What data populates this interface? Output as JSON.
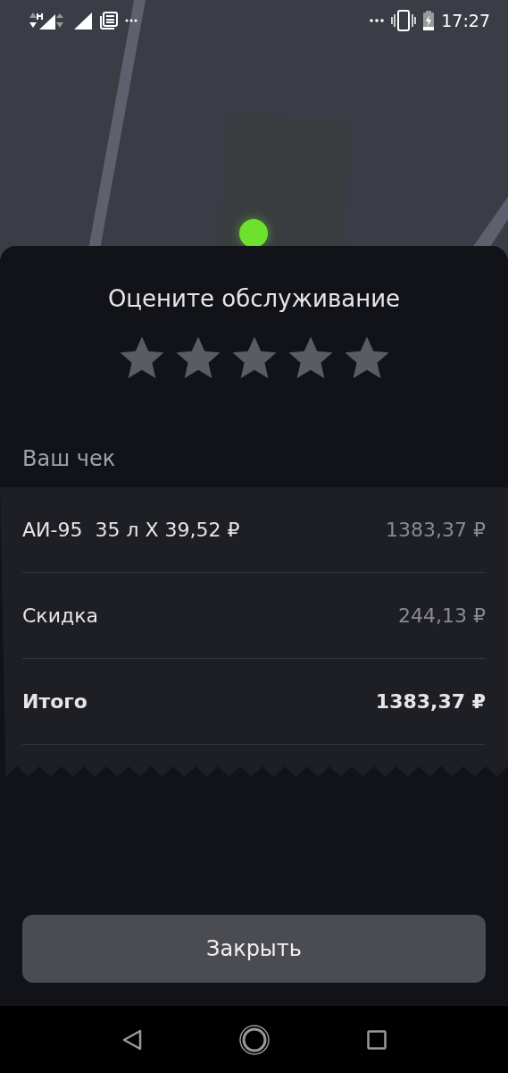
{
  "status_bar": {
    "time": "17:27"
  },
  "rating": {
    "title": "Оцените обслуживание",
    "stars": 0
  },
  "receipt": {
    "title": "Ваш чек",
    "rows": [
      {
        "kind": "item",
        "label": "АИ-95  35 л X 39,52 ₽",
        "value": "1383,37 ₽"
      },
      {
        "kind": "item",
        "label": "Скидка",
        "value": "244,13 ₽"
      },
      {
        "kind": "total",
        "label": "Итого",
        "value": "1383,37 ₽"
      }
    ]
  },
  "close_button": {
    "label": "Закрыть"
  }
}
